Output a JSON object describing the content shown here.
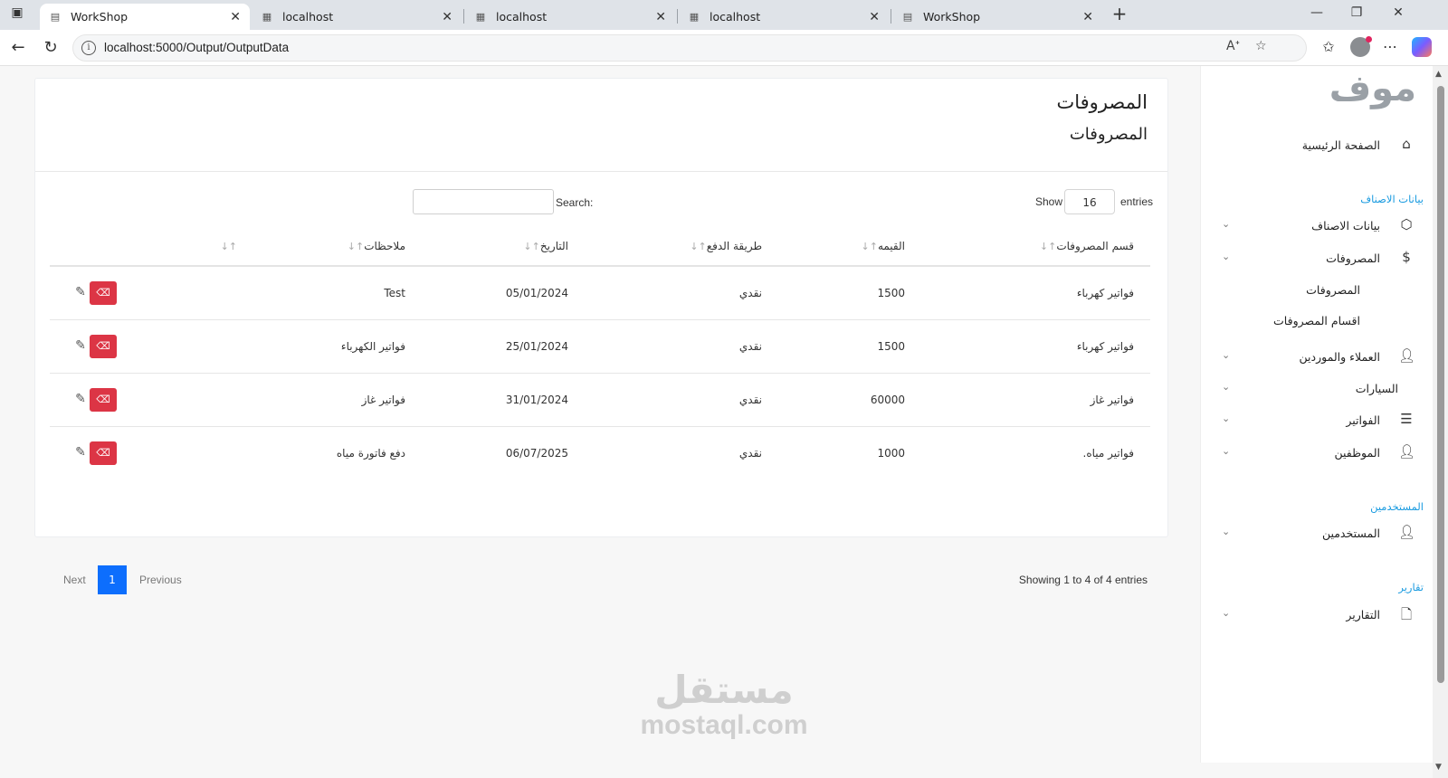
{
  "browser": {
    "tabs": [
      {
        "title": "WorkShop",
        "active": true,
        "icon": "page-icon"
      },
      {
        "title": "localhost",
        "active": false,
        "icon": "file-icon"
      },
      {
        "title": "localhost",
        "active": false,
        "icon": "file-icon"
      },
      {
        "title": "localhost",
        "active": false,
        "icon": "file-icon"
      },
      {
        "title": "WorkShop",
        "active": false,
        "icon": "page-icon"
      }
    ],
    "url": "localhost:5000/Output/OutputData"
  },
  "card": {
    "title": "المصروفات",
    "subtitle": "المصروفات"
  },
  "table_controls": {
    "show_label": "Show",
    "entries_value": "16",
    "entries_label": "entries",
    "search_label": "Search:",
    "search_value": ""
  },
  "table": {
    "headers": [
      "قسم المصروفات",
      "القيمه",
      "طريقة الدفع",
      "التاريخ",
      "ملاحظات",
      ""
    ],
    "rows": [
      {
        "category": "فواتير كهرباء",
        "value": "1500",
        "method": "نقدي",
        "date": "05/01/2024",
        "notes": "Test"
      },
      {
        "category": "فواتير كهرباء",
        "value": "1500",
        "method": "نقدي",
        "date": "25/01/2024",
        "notes": "فواتير الكهرباء"
      },
      {
        "category": "فواتير غاز",
        "value": "60000",
        "method": "نقدي",
        "date": "31/01/2024",
        "notes": "فواتير غاز"
      },
      {
        "category": "فواتير مياه.",
        "value": "1000",
        "method": "نقدي",
        "date": "06/07/2025",
        "notes": "دفع فاتورة مياه"
      }
    ]
  },
  "footer": {
    "info": "Showing 1 to 4 of 4 entries",
    "previous": "Previous",
    "current_page": "1",
    "next": "Next"
  },
  "sidebar": {
    "logo": "موف",
    "home": "الصفحة الرئيسية",
    "section_items": "بيانات الاصناف",
    "items_label": "بيانات الاصناف",
    "expenses_label": "المصروفات",
    "expenses_sub_1": "المصروفات",
    "expenses_sub_2": "اقسام المصروفات",
    "clients_label": "العملاء والموردين",
    "cars_label": "السيارات",
    "invoices_label": "الفواتير",
    "employees_label": "الموظفين",
    "section_users": "المستخدمين",
    "users_label": "المستخدمين",
    "section_reports": "تقارير",
    "reports_label": "التقارير"
  },
  "watermark": {
    "arabic": "مستقل",
    "latin": "mostaql.com"
  },
  "colors": {
    "accent": "#1a9be0",
    "danger": "#dc3545",
    "primary": "#0d6efd"
  }
}
